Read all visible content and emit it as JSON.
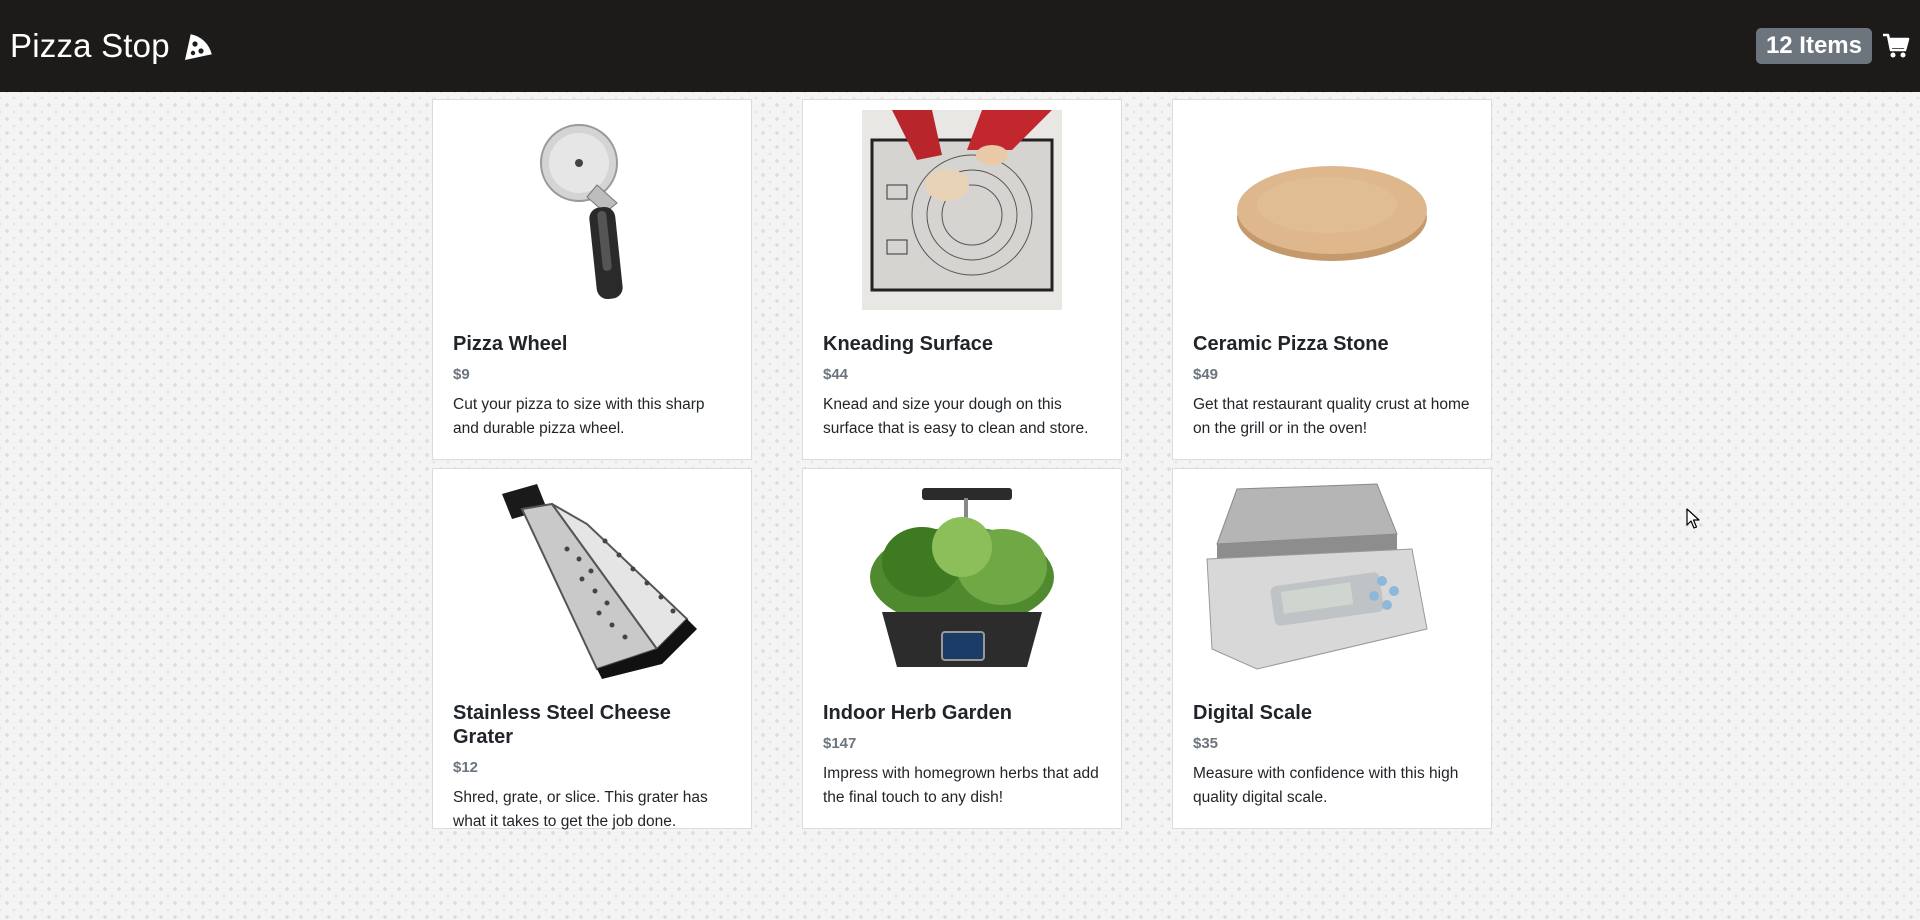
{
  "brand": {
    "title": "Pizza Stop",
    "icon": "pizza-slice-icon"
  },
  "cart": {
    "count_label": "12 Items",
    "icon": "shopping-cart-icon"
  },
  "colors": {
    "navbar": "#1d1b1a",
    "badge": "#6c757d",
    "price": "#6c757d"
  },
  "products": [
    {
      "name": "Pizza Wheel",
      "price": "$9",
      "description": "Cut your pizza to size with this sharp and durable pizza wheel.",
      "image": "pizza-wheel-image"
    },
    {
      "name": "Kneading Surface",
      "price": "$44",
      "description": "Knead and size your dough on this surface that is easy to clean and store.",
      "image": "kneading-surface-image"
    },
    {
      "name": "Ceramic Pizza Stone",
      "price": "$49",
      "description": "Get that restaurant quality crust at home on the grill or in the oven!",
      "image": "pizza-stone-image"
    },
    {
      "name": "Stainless Steel Cheese Grater",
      "price": "$12",
      "description": "Shred, grate, or slice. This grater has what it takes to get the job done.",
      "image": "cheese-grater-image"
    },
    {
      "name": "Indoor Herb Garden",
      "price": "$147",
      "description": "Impress with homegrown herbs that add the final touch to any dish!",
      "image": "herb-garden-image"
    },
    {
      "name": "Digital Scale",
      "price": "$35",
      "description": "Measure with confidence with this high quality digital scale.",
      "image": "digital-scale-image"
    }
  ]
}
